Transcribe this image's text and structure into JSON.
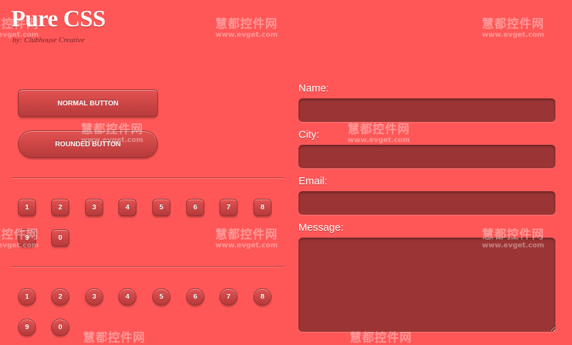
{
  "header": {
    "title": "Pure CSS",
    "byline": "by: Clubhouse Creative"
  },
  "buttons": {
    "normal_label": "NORMAL BUTTON",
    "rounded_label": "ROUNDED BUTTON"
  },
  "number_buttons_square": [
    "1",
    "2",
    "3",
    "4",
    "5",
    "6",
    "7",
    "8",
    "9",
    "0"
  ],
  "number_buttons_rounded": [
    "1",
    "2",
    "3",
    "4",
    "5",
    "6",
    "7",
    "8",
    "9",
    "0"
  ],
  "form": {
    "name_label": "Name:",
    "city_label": "City:",
    "email_label": "Email:",
    "message_label": "Message:",
    "name_value": "",
    "city_value": "",
    "email_value": "",
    "message_value": ""
  },
  "watermark": {
    "cn": "慧都控件网",
    "en": "www.evget.com"
  },
  "colors": {
    "background": "#ff5757",
    "button": "#c94545",
    "field": "#9b3535",
    "text": "#ffffff"
  }
}
